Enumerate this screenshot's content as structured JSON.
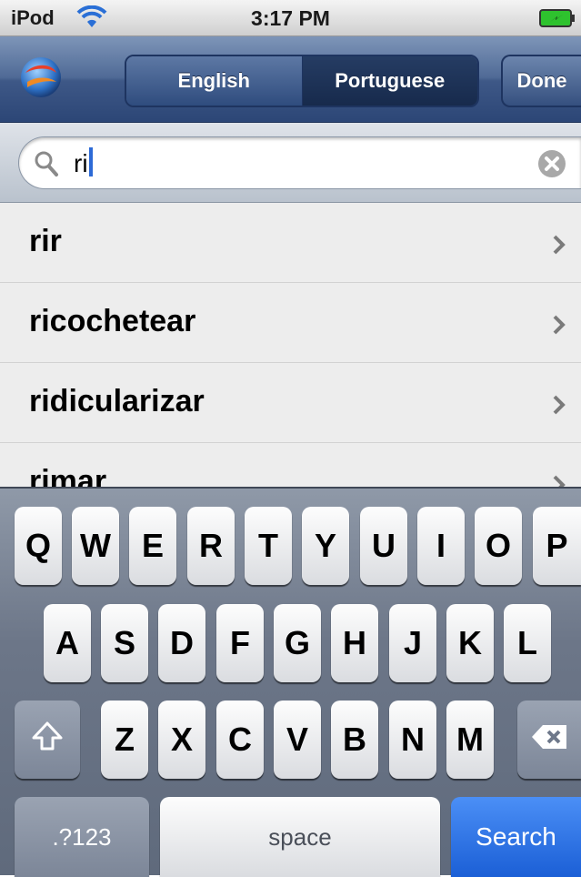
{
  "status_bar": {
    "carrier": "iPod",
    "time": "3:17 PM"
  },
  "navbar": {
    "segments": [
      "English",
      "Portuguese"
    ],
    "selected_segment": "Portuguese",
    "done_label": "Done"
  },
  "search": {
    "value": "ri"
  },
  "results": [
    {
      "word": "rir"
    },
    {
      "word": "ricochetear"
    },
    {
      "word": "ridicularizar"
    },
    {
      "word": "rimar"
    }
  ],
  "keyboard": {
    "row1": [
      "Q",
      "W",
      "E",
      "R",
      "T",
      "Y",
      "U",
      "I",
      "O",
      "P"
    ],
    "row2": [
      "A",
      "S",
      "D",
      "F",
      "G",
      "H",
      "J",
      "K",
      "L"
    ],
    "row3": [
      "Z",
      "X",
      "C",
      "V",
      "B",
      "N",
      "M"
    ],
    "numbers_label": ".?123",
    "space_label": "space",
    "search_label": "Search"
  },
  "colors": {
    "navbar": "#3e5887",
    "accent_blue": "#1b5fd6",
    "list_background": "#ededed",
    "keyboard": "#6c7688"
  },
  "icons": [
    "wifi-icon",
    "battery-icon",
    "app-logo-icon",
    "search-icon",
    "clear-icon",
    "chevron-right-icon",
    "shift-icon",
    "backspace-icon"
  ]
}
